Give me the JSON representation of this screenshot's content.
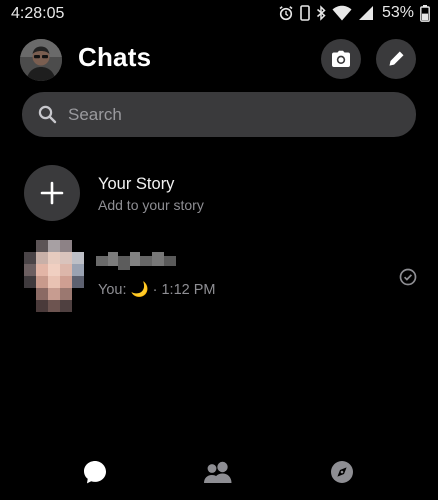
{
  "status_bar": {
    "time": "4:28:05",
    "battery": "53%",
    "icons": [
      "alarm-icon",
      "phone-icon",
      "bluetooth-icon",
      "wifi-icon",
      "signal-icon",
      "battery-icon"
    ]
  },
  "header": {
    "title": "Chats",
    "avatar": "profile-avatar",
    "actions": [
      "camera-icon",
      "pencil-icon"
    ]
  },
  "search": {
    "placeholder": "Search",
    "value": ""
  },
  "story": {
    "title": "Your Story",
    "subtitle": "Add to your story"
  },
  "chats": [
    {
      "name_visible": false,
      "preview_prefix": "You: ",
      "preview_emoji": "🌙",
      "separator": " · ",
      "time": "1:12 PM",
      "status": "check-circle-icon"
    }
  ],
  "nav": {
    "items": [
      "chat-bubble-icon",
      "people-icon",
      "compass-icon"
    ],
    "active_index": 0
  },
  "colors": {
    "background": "#000000",
    "surface": "#3a3a3c",
    "text_primary": "#ffffff",
    "text_secondary": "#8e8e93"
  }
}
